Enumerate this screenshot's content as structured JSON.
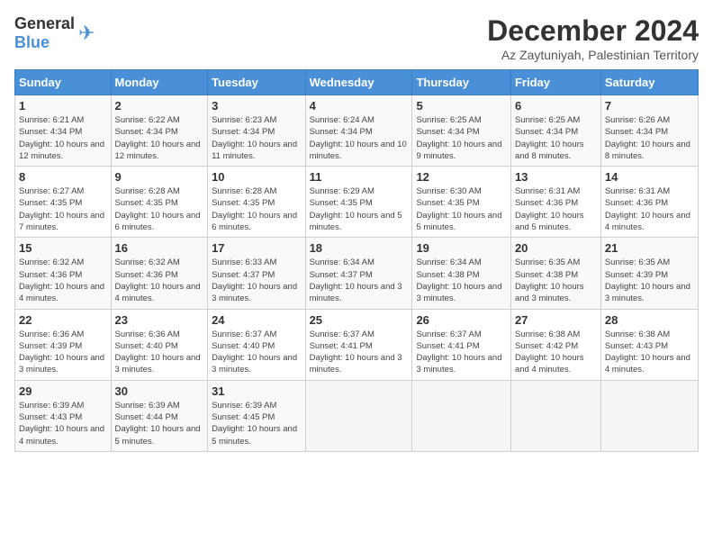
{
  "logo": {
    "general": "General",
    "blue": "Blue"
  },
  "title": "December 2024",
  "location": "Az Zaytuniyah, Palestinian Territory",
  "days_header": [
    "Sunday",
    "Monday",
    "Tuesday",
    "Wednesday",
    "Thursday",
    "Friday",
    "Saturday"
  ],
  "weeks": [
    [
      {
        "day": "1",
        "sunrise": "Sunrise: 6:21 AM",
        "sunset": "Sunset: 4:34 PM",
        "daylight": "Daylight: 10 hours and 12 minutes."
      },
      {
        "day": "2",
        "sunrise": "Sunrise: 6:22 AM",
        "sunset": "Sunset: 4:34 PM",
        "daylight": "Daylight: 10 hours and 12 minutes."
      },
      {
        "day": "3",
        "sunrise": "Sunrise: 6:23 AM",
        "sunset": "Sunset: 4:34 PM",
        "daylight": "Daylight: 10 hours and 11 minutes."
      },
      {
        "day": "4",
        "sunrise": "Sunrise: 6:24 AM",
        "sunset": "Sunset: 4:34 PM",
        "daylight": "Daylight: 10 hours and 10 minutes."
      },
      {
        "day": "5",
        "sunrise": "Sunrise: 6:25 AM",
        "sunset": "Sunset: 4:34 PM",
        "daylight": "Daylight: 10 hours and 9 minutes."
      },
      {
        "day": "6",
        "sunrise": "Sunrise: 6:25 AM",
        "sunset": "Sunset: 4:34 PM",
        "daylight": "Daylight: 10 hours and 8 minutes."
      },
      {
        "day": "7",
        "sunrise": "Sunrise: 6:26 AM",
        "sunset": "Sunset: 4:34 PM",
        "daylight": "Daylight: 10 hours and 8 minutes."
      }
    ],
    [
      {
        "day": "8",
        "sunrise": "Sunrise: 6:27 AM",
        "sunset": "Sunset: 4:35 PM",
        "daylight": "Daylight: 10 hours and 7 minutes."
      },
      {
        "day": "9",
        "sunrise": "Sunrise: 6:28 AM",
        "sunset": "Sunset: 4:35 PM",
        "daylight": "Daylight: 10 hours and 6 minutes."
      },
      {
        "day": "10",
        "sunrise": "Sunrise: 6:28 AM",
        "sunset": "Sunset: 4:35 PM",
        "daylight": "Daylight: 10 hours and 6 minutes."
      },
      {
        "day": "11",
        "sunrise": "Sunrise: 6:29 AM",
        "sunset": "Sunset: 4:35 PM",
        "daylight": "Daylight: 10 hours and 5 minutes."
      },
      {
        "day": "12",
        "sunrise": "Sunrise: 6:30 AM",
        "sunset": "Sunset: 4:35 PM",
        "daylight": "Daylight: 10 hours and 5 minutes."
      },
      {
        "day": "13",
        "sunrise": "Sunrise: 6:31 AM",
        "sunset": "Sunset: 4:36 PM",
        "daylight": "Daylight: 10 hours and 5 minutes."
      },
      {
        "day": "14",
        "sunrise": "Sunrise: 6:31 AM",
        "sunset": "Sunset: 4:36 PM",
        "daylight": "Daylight: 10 hours and 4 minutes."
      }
    ],
    [
      {
        "day": "15",
        "sunrise": "Sunrise: 6:32 AM",
        "sunset": "Sunset: 4:36 PM",
        "daylight": "Daylight: 10 hours and 4 minutes."
      },
      {
        "day": "16",
        "sunrise": "Sunrise: 6:32 AM",
        "sunset": "Sunset: 4:36 PM",
        "daylight": "Daylight: 10 hours and 4 minutes."
      },
      {
        "day": "17",
        "sunrise": "Sunrise: 6:33 AM",
        "sunset": "Sunset: 4:37 PM",
        "daylight": "Daylight: 10 hours and 3 minutes."
      },
      {
        "day": "18",
        "sunrise": "Sunrise: 6:34 AM",
        "sunset": "Sunset: 4:37 PM",
        "daylight": "Daylight: 10 hours and 3 minutes."
      },
      {
        "day": "19",
        "sunrise": "Sunrise: 6:34 AM",
        "sunset": "Sunset: 4:38 PM",
        "daylight": "Daylight: 10 hours and 3 minutes."
      },
      {
        "day": "20",
        "sunrise": "Sunrise: 6:35 AM",
        "sunset": "Sunset: 4:38 PM",
        "daylight": "Daylight: 10 hours and 3 minutes."
      },
      {
        "day": "21",
        "sunrise": "Sunrise: 6:35 AM",
        "sunset": "Sunset: 4:39 PM",
        "daylight": "Daylight: 10 hours and 3 minutes."
      }
    ],
    [
      {
        "day": "22",
        "sunrise": "Sunrise: 6:36 AM",
        "sunset": "Sunset: 4:39 PM",
        "daylight": "Daylight: 10 hours and 3 minutes."
      },
      {
        "day": "23",
        "sunrise": "Sunrise: 6:36 AM",
        "sunset": "Sunset: 4:40 PM",
        "daylight": "Daylight: 10 hours and 3 minutes."
      },
      {
        "day": "24",
        "sunrise": "Sunrise: 6:37 AM",
        "sunset": "Sunset: 4:40 PM",
        "daylight": "Daylight: 10 hours and 3 minutes."
      },
      {
        "day": "25",
        "sunrise": "Sunrise: 6:37 AM",
        "sunset": "Sunset: 4:41 PM",
        "daylight": "Daylight: 10 hours and 3 minutes."
      },
      {
        "day": "26",
        "sunrise": "Sunrise: 6:37 AM",
        "sunset": "Sunset: 4:41 PM",
        "daylight": "Daylight: 10 hours and 3 minutes."
      },
      {
        "day": "27",
        "sunrise": "Sunrise: 6:38 AM",
        "sunset": "Sunset: 4:42 PM",
        "daylight": "Daylight: 10 hours and 4 minutes."
      },
      {
        "day": "28",
        "sunrise": "Sunrise: 6:38 AM",
        "sunset": "Sunset: 4:43 PM",
        "daylight": "Daylight: 10 hours and 4 minutes."
      }
    ],
    [
      {
        "day": "29",
        "sunrise": "Sunrise: 6:39 AM",
        "sunset": "Sunset: 4:43 PM",
        "daylight": "Daylight: 10 hours and 4 minutes."
      },
      {
        "day": "30",
        "sunrise": "Sunrise: 6:39 AM",
        "sunset": "Sunset: 4:44 PM",
        "daylight": "Daylight: 10 hours and 5 minutes."
      },
      {
        "day": "31",
        "sunrise": "Sunrise: 6:39 AM",
        "sunset": "Sunset: 4:45 PM",
        "daylight": "Daylight: 10 hours and 5 minutes."
      },
      null,
      null,
      null,
      null
    ]
  ]
}
